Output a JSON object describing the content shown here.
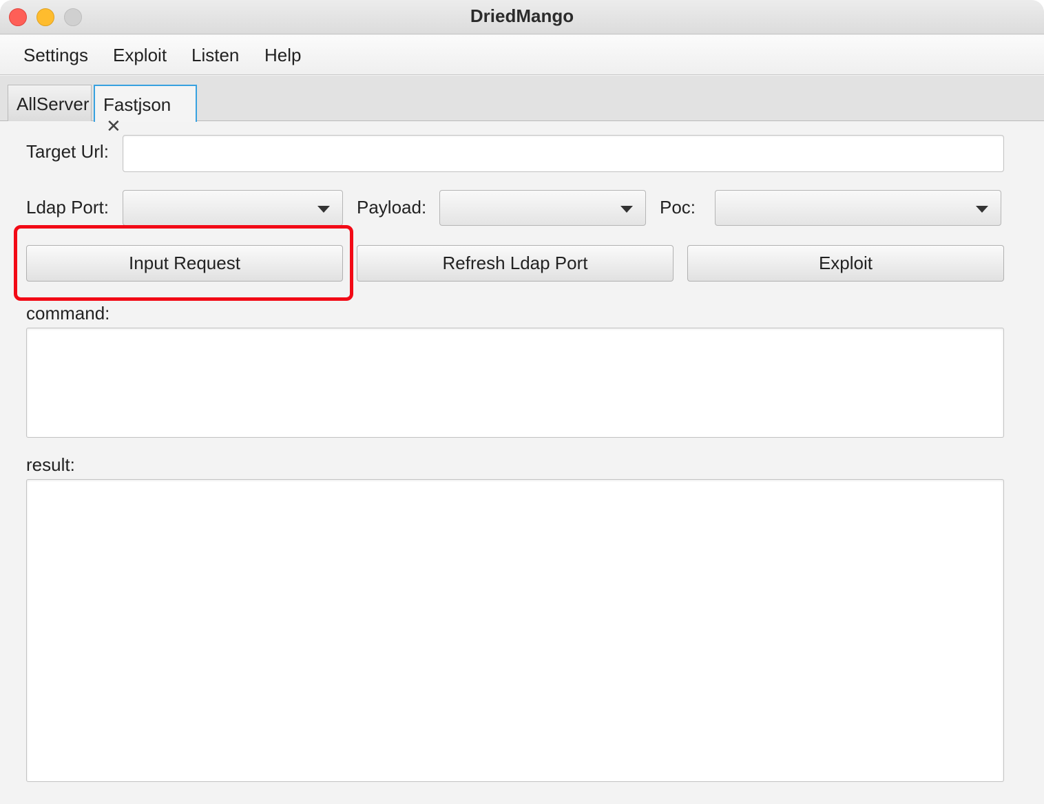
{
  "window": {
    "title": "DriedMango"
  },
  "menu": {
    "items": [
      {
        "label": "Settings"
      },
      {
        "label": "Exploit"
      },
      {
        "label": "Listen"
      },
      {
        "label": "Help"
      }
    ]
  },
  "tabs": {
    "items": [
      {
        "label": "AllServer",
        "active": false
      },
      {
        "label": "Fastjson",
        "active": true,
        "closable": true
      }
    ],
    "close_glyph": "✕"
  },
  "form": {
    "target_url_label": "Target Url:",
    "target_url_value": "",
    "ldap_port_label": "Ldap Port:",
    "ldap_port_value": "",
    "payload_label": "Payload:",
    "payload_value": "",
    "poc_label": "Poc:",
    "poc_value": "",
    "input_request_button": "Input Request",
    "refresh_ldap_button": "Refresh Ldap Port",
    "exploit_button": "Exploit",
    "command_label": "command:",
    "command_value": "",
    "result_label": "result:",
    "result_value": ""
  },
  "annotation": {
    "highlight_color": "#f20a16",
    "highlighted_element": "input-request-button"
  },
  "colors": {
    "active_tab_border": "#36a1e0",
    "traffic_close": "#fe5f57",
    "traffic_minimize": "#febc2e",
    "traffic_maximize_disabled": "#d0d0d0"
  }
}
